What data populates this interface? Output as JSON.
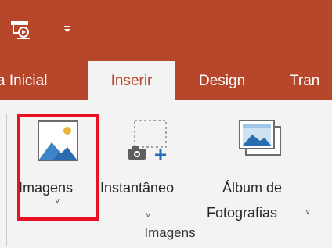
{
  "tabs": {
    "home": "a Inicial",
    "insert": "Inserir",
    "design": "Design",
    "transitions": "Tran"
  },
  "quick_access": {
    "customize_glyph": "₹"
  },
  "ribbon": {
    "images_button": {
      "label": "Imagens",
      "chevron": "˅"
    },
    "screenshot_button": {
      "label": "Instantâneo",
      "chevron": "˅"
    },
    "album_button": {
      "label_line1": "Álbum de",
      "label_line2": "Fotografias",
      "chevron": "˅"
    },
    "group_label": "Imagens"
  },
  "colors": {
    "accent": "#b7472a",
    "ribbon_bg": "#f3f3f3",
    "highlight": "#e81123"
  },
  "icons": [
    "presenter-icon",
    "customize-qat-icon",
    "pictures-icon",
    "screenshot-icon",
    "photo-album-icon"
  ]
}
